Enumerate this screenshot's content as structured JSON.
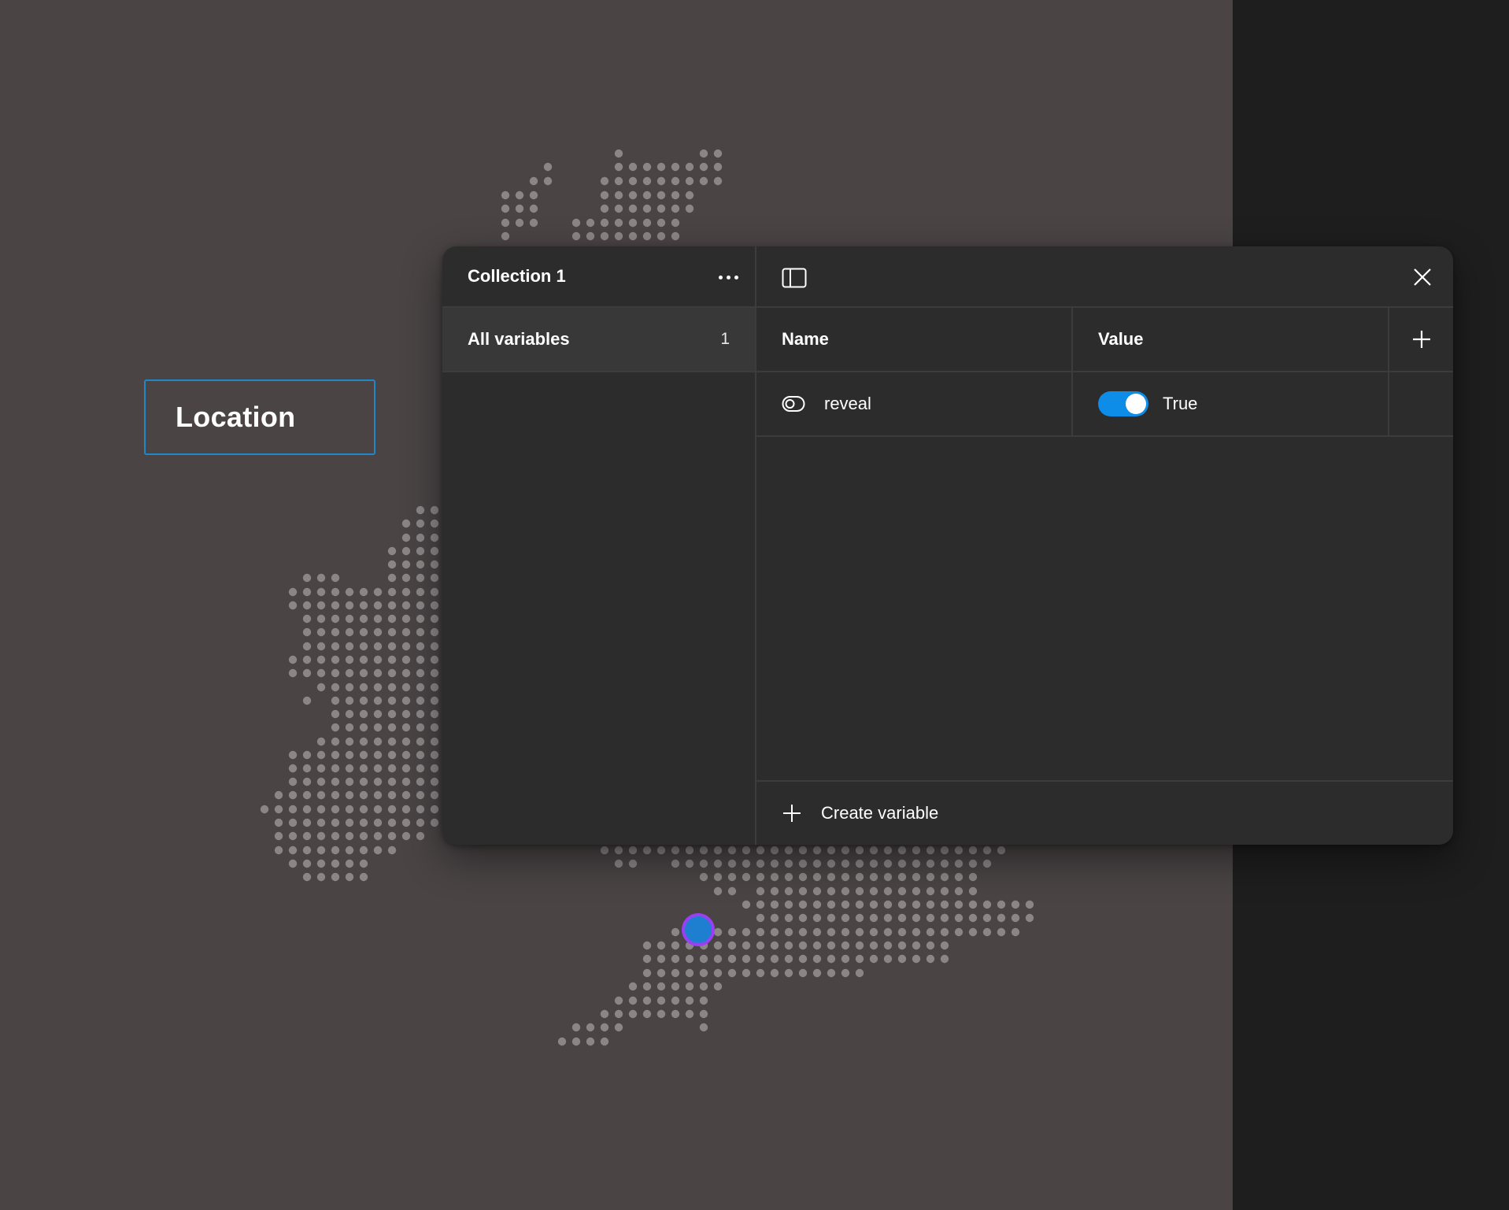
{
  "canvas": {
    "background": "#4a4445",
    "side_strip_color": "#1e1e1e",
    "dot_color": "#8b8587",
    "location_label": "Location",
    "location_border_color": "#1e88c8",
    "pin_fill_color": "#1e7fd0",
    "pin_ring_color": "#9b3ff2"
  },
  "variables_panel": {
    "collection_title": "Collection 1",
    "collection_menu_icon": "more-horizontal-icon",
    "all_variables_label": "All variables",
    "all_variables_count": "1",
    "sidebar_toggle_icon": "sidebar-toggle-icon",
    "close_icon": "close-icon",
    "table": {
      "columns": [
        "Name",
        "Value"
      ],
      "add_column_icon": "plus-icon",
      "rows": [
        {
          "type_icon": "boolean-toggle-icon",
          "name": "reveal",
          "value_enabled": true,
          "value_label": "True"
        }
      ]
    },
    "create_variable_icon": "plus-icon",
    "create_variable_label": "Create variable",
    "accent_color": "#0d8ce8"
  }
}
